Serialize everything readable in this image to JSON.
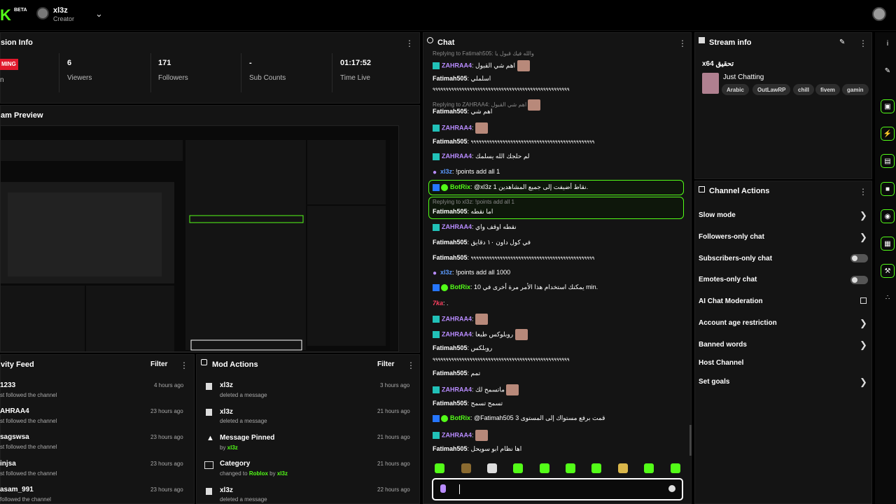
{
  "brand": {
    "logo": "K",
    "beta": "BETA"
  },
  "user": {
    "name": "xl3z",
    "role": "Creator"
  },
  "session": {
    "title": "sion Info",
    "status": "MING",
    "status_sub": "n",
    "stats": [
      {
        "value": "6",
        "label": "Viewers"
      },
      {
        "value": "171",
        "label": "Followers"
      },
      {
        "value": "-",
        "label": "Sub Counts"
      },
      {
        "value": "01:17:52",
        "label": "Time Live"
      }
    ]
  },
  "preview": {
    "title": "am Preview"
  },
  "feed": {
    "title": "vity Feed",
    "filter": "Filter",
    "items": [
      {
        "title": "1233",
        "sub": "st followed the channel",
        "time": "4 hours ago"
      },
      {
        "title": "AHRAA4",
        "sub": "st followed the channel",
        "time": "23 hours ago"
      },
      {
        "title": "sagswsa",
        "sub": "st followed the channel",
        "time": "23 hours ago"
      },
      {
        "title": "injsa",
        "sub": "st followed the channel",
        "time": "23 hours ago"
      },
      {
        "title": "asam_991",
        "sub": "followed the channel",
        "time": "23 hours ago"
      }
    ]
  },
  "mod": {
    "title": "Mod Actions",
    "filter": "Filter",
    "items": [
      {
        "title": "xl3z",
        "sub": "deleted a message",
        "time": "3 hours ago",
        "icon": "trash-icon"
      },
      {
        "title": "xl3z",
        "sub": "deleted a message",
        "time": "21 hours ago",
        "icon": "trash-icon"
      },
      {
        "title": "Message Pinned",
        "sub_pre": "by ",
        "sub_link": "xl3z",
        "time": "21 hours ago",
        "icon": "pin-icon"
      },
      {
        "title": "Category",
        "sub_pre": "changed to ",
        "sub_link": "Roblox",
        "sub_mid": " by ",
        "sub_link2": "xl3z",
        "time": "21 hours ago",
        "icon": "category-icon"
      },
      {
        "title": "xl3z",
        "sub": "deleted a message",
        "time": "22 hours ago",
        "icon": "trash-icon"
      }
    ]
  },
  "chat": {
    "title": "Chat",
    "messages": [
      {
        "reply": "Replying to Fatimah505: والله فيك قبول يا"
      },
      {
        "name": "ZAHRAA4",
        "text": "اهم شي القبول"
      },
      {
        "name": "Fatimah505",
        "text": "اسلملي"
      },
      {
        "text": "٩٩٩٩٩٩٩٩٩٩٩٩٩٩٩٩٩٩٩٩٩٩٩٩٩٩٩٩٩٩٩٩٩٩٩٩٩٩٩٩٩٩٩٩٩٩٩٩٩٩٩٩"
      },
      {
        "reply": "Replying to ZAHRAA4: اهم شي القبول"
      },
      {
        "name": "Fatimah505",
        "text": "اهم شي"
      },
      {
        "name": "ZAHRAA4",
        "text": ""
      },
      {
        "name": "Fatimah505",
        "text": "٩٩٩٩٩٩٩٩٩٩٩٩٩٩٩٩٩٩٩٩٩٩٩٩٩٩٩٩٩٩٩٩٩٩٩٩٩٩٩٩٩٩٩٩٩٩٩"
      },
      {
        "name": "ZAHRAA4",
        "text": "لم حلجك الله يسلمك"
      },
      {
        "name": "xl3z",
        "text": "!points add all 1"
      },
      {
        "name": "BotRix",
        "text": "@xl3z 1 نقاط أضيفت إلى جميع المشاهدين."
      },
      {
        "reply": "Replying to xl3z: !points add all 1"
      },
      {
        "name": "Fatimah505",
        "text": "اما نقطه"
      },
      {
        "name": "ZAHRAA4",
        "text": "نقطه اوقف واي"
      },
      {
        "name": "Fatimah505",
        "text": "في كول داون ١٠ دقايق"
      },
      {
        "name": "Fatimah505",
        "text": "٩٩٩٩٩٩٩٩٩٩٩٩٩٩٩٩٩٩٩٩٩٩٩٩٩٩٩٩٩٩٩٩٩٩٩٩٩٩٩٩٩٩٩٩٩٩٩"
      },
      {
        "name": "xl3z",
        "text": "!points add all 1000"
      },
      {
        "name": "BotRix",
        "text": "يمكنك استخدام هذا الأمر مرة أخرى في 10 min."
      },
      {
        "name": "7ka",
        "text": "."
      },
      {
        "name": "ZAHRAA4",
        "text": ""
      },
      {
        "name": "ZAHRAA4",
        "text": "روبلوكس طبعا"
      },
      {
        "name": "Fatimah505",
        "text": "روبلكس"
      },
      {
        "text": "٩٩٩٩٩٩٩٩٩٩٩٩٩٩٩٩٩٩٩٩٩٩٩٩٩٩٩٩٩٩٩٩٩٩٩٩٩٩٩٩٩٩٩٩٩٩٩٩٩٩٩٩"
      },
      {
        "name": "Fatimah505",
        "text": "تمم"
      },
      {
        "name": "ZAHRAA4",
        "text": "ماتسمح لك"
      },
      {
        "name": "Fatimah505",
        "text": "تسمح تسمح"
      },
      {
        "name": "BotRix",
        "text": "@Fatimah505 قمت برفع مستواك إلى المستوى 3"
      },
      {
        "name": "ZAHRAA4",
        "text": ""
      },
      {
        "name": "Fatimah505",
        "text": "اها نظام ابو سويحل"
      }
    ]
  },
  "stream": {
    "title": "Stream info",
    "name": "x64 تحقيق",
    "category": "Just Chatting",
    "tags": [
      "Arabic",
      "OutLawRP",
      "chill",
      "fivem",
      "gamin"
    ]
  },
  "actions": {
    "title": "Channel Actions",
    "items": [
      {
        "label": "Slow mode",
        "type": "arrow"
      },
      {
        "label": "Followers-only chat",
        "type": "arrow"
      },
      {
        "label": "Subscribers-only chat",
        "type": "toggle"
      },
      {
        "label": "Emotes-only chat",
        "type": "toggle"
      },
      {
        "label": "AI Chat Moderation",
        "type": "external"
      },
      {
        "label": "Account age restriction",
        "type": "arrow"
      },
      {
        "label": "Banned words",
        "type": "arrow"
      },
      {
        "label": "Host Channel",
        "type": "none"
      },
      {
        "label": "Set goals",
        "type": "arrow"
      }
    ]
  },
  "colors": {
    "accent": "#53fc18",
    "live": "#e0182c",
    "panel": "#141414"
  }
}
